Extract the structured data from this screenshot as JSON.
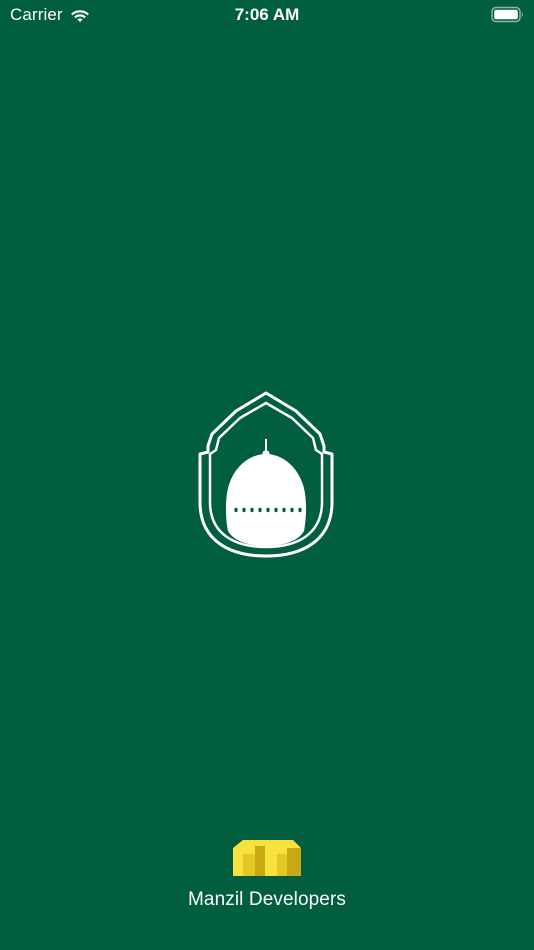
{
  "status_bar": {
    "carrier": "Carrier",
    "time": "7:06 AM"
  },
  "icons": {
    "wifi": "wifi-icon",
    "battery": "battery-icon",
    "app_logo": "mosque-dome-icon",
    "developer_logo": "manzil-m-icon"
  },
  "footer": {
    "developer_name": "Manzil Developers"
  },
  "colors": {
    "background": "#015e3f",
    "text": "#ffffff",
    "developer_logo_light": "#f6e23a",
    "developer_logo_dark": "#c9a816"
  }
}
